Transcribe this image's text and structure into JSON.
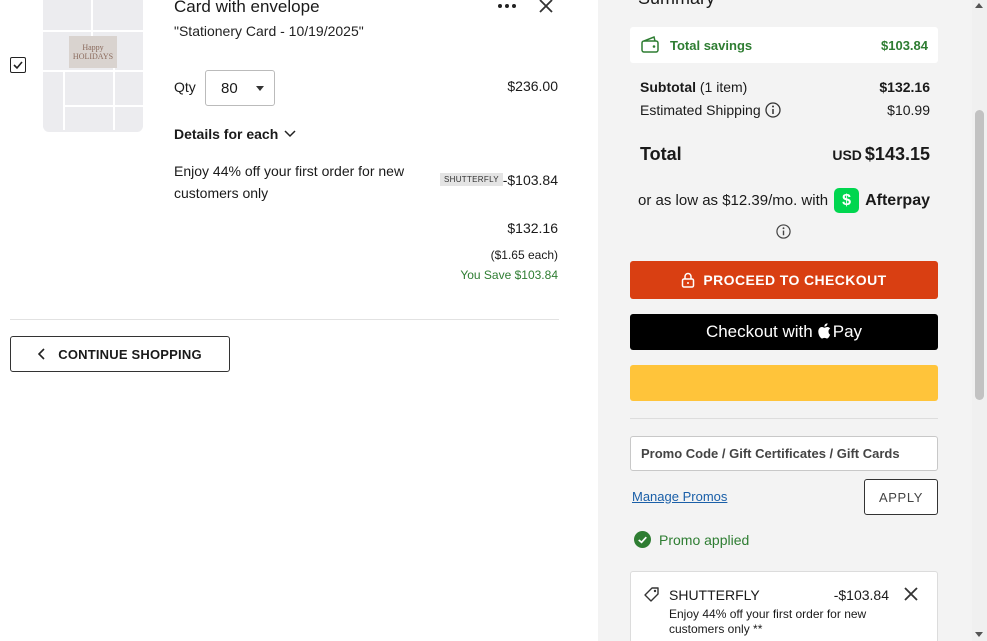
{
  "item": {
    "title": "Card with envelope",
    "subtitle": "\"Stationery Card - 10/19/2025\"",
    "thumbnail_text_1": "Happy",
    "thumbnail_text_2": "HOLIDAYS",
    "qty_label": "Qty",
    "qty_value": "80",
    "line_price": "$236.00",
    "details_label": "Details for each",
    "promo_description": "Enjoy 44% off your first order for new customers only",
    "promo_badge": "SHUTTERFLY",
    "promo_amount": "-$103.84",
    "net_price": "$132.16",
    "each_price": "($1.65 each)",
    "you_save": "You Save $103.84",
    "selected": true
  },
  "continue_label": "CONTINUE SHOPPING",
  "summary": {
    "title": "Summary",
    "total_savings_label": "Total savings",
    "total_savings_value": "$103.84",
    "subtotal_label": "Subtotal",
    "subtotal_count": "(1 item)",
    "subtotal_value": "$132.16",
    "shipping_label": "Estimated Shipping",
    "shipping_value": "$10.99",
    "total_label": "Total",
    "total_currency": "USD",
    "total_value": "$143.15",
    "afterpay_text": "or as low as $12.39/mo. with",
    "afterpay_brand": "Afterpay",
    "checkout_label": "PROCEED TO CHECKOUT",
    "applepay_label": "Checkout with",
    "applepay_brand": "Pay",
    "promo_placeholder": "Promo Code / Gift Certificates / Gift Cards",
    "manage_promos_label": "Manage Promos",
    "apply_label": "APPLY",
    "promo_applied_label": "Promo applied",
    "applied_promo": {
      "code": "SHUTTERFLY",
      "amount": "-$103.84",
      "description": "Enjoy 44% off your first order for new customers only **"
    }
  },
  "colors": {
    "checkout": "#d93f12",
    "paypal": "#ffc43a",
    "success": "#2e7d32",
    "afterpay": "#00d64f",
    "link": "#1a5fa8"
  }
}
